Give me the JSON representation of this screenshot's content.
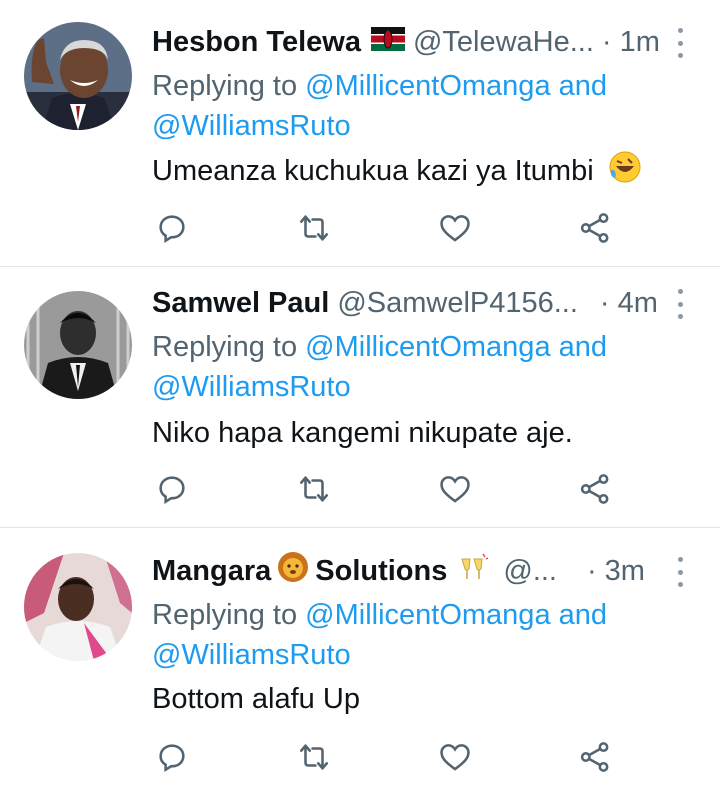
{
  "replies": [
    {
      "name": "Hesbon Telewa",
      "handle": "@TelewaHe...",
      "separator": "·",
      "time": "1m",
      "replying_prefix": "Replying to ",
      "replying_line1_link": "@MillicentOmanga and",
      "replying_line2_link": "@WilliamsRuto",
      "text": "Umeanza kuchukua kazi ya Itumbi",
      "name_emoji": "kenya-flag",
      "text_emoji": "rolling-on-floor-laughing"
    },
    {
      "name": "Samwel Paul",
      "handle": "@SamwelP4156...",
      "separator": "·",
      "time": "4m",
      "replying_prefix": "Replying to ",
      "replying_line1_link": "@MillicentOmanga and",
      "replying_line2_link": "@WilliamsRuto",
      "text": "Niko hapa kangemi  nikupate aje."
    },
    {
      "name_part1": "Mangara",
      "name_part2": "Solutions",
      "handle": "@...",
      "separator": "·",
      "time": "3m",
      "replying_prefix": "Replying to ",
      "replying_line1_link": "@MillicentOmanga and",
      "replying_line2_link": "@WilliamsRuto",
      "text": "Bottom alafu Up",
      "name_emojis": [
        "lion-face",
        "clinking-glasses"
      ]
    }
  ],
  "colors": {
    "link": "#1d9bf0",
    "secondary": "#536471",
    "icon": "#536471",
    "divider": "#e1e6ea"
  },
  "action_icons": [
    "reply-icon",
    "retweet-icon",
    "like-icon",
    "share-icon"
  ]
}
